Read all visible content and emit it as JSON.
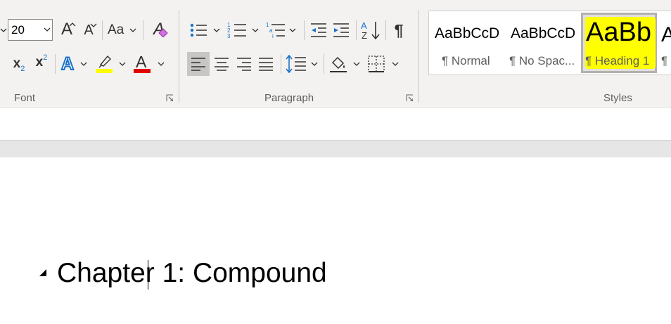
{
  "font": {
    "size_value": "20",
    "grow_label": "A",
    "shrink_label": "A",
    "change_case_label": "Aa",
    "clear_formatting_label": "A",
    "subscript_label": "x",
    "subscript_mark": "2",
    "superscript_label": "x",
    "superscript_mark": "2",
    "text_effects_label": "A",
    "font_color_label": "A",
    "highlight_color": "#ffff00",
    "font_color": "#e00000",
    "group_label": "Font"
  },
  "paragraph": {
    "show_marks_label": "¶",
    "group_label": "Paragraph"
  },
  "styles": {
    "items": [
      {
        "preview": "AaBbCcDc",
        "name": "¶ Normal"
      },
      {
        "preview": "AaBbCcDc",
        "name": "¶ No Spac..."
      },
      {
        "preview": "AaBb",
        "name": "¶ Heading 1"
      },
      {
        "preview": "A",
        "name": "¶ H"
      }
    ],
    "group_label": "Styles",
    "highlight_color": "#ffff00"
  },
  "document": {
    "heading_text": "Chapter 1: Compound"
  }
}
